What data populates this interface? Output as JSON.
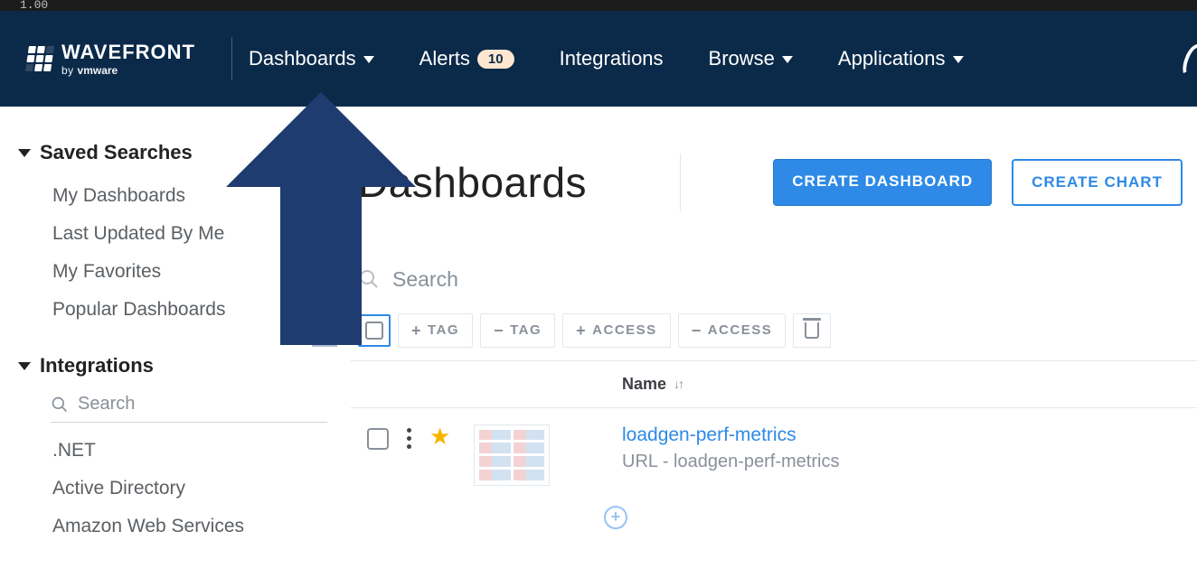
{
  "chrome": {
    "time": "1.00"
  },
  "brand": {
    "main": "WAVEFRONT",
    "sub_prefix": "by ",
    "sub_bold": "vmware"
  },
  "nav": {
    "dashboards": "Dashboards",
    "alerts": "Alerts",
    "alerts_badge": "10",
    "integrations": "Integrations",
    "browse": "Browse",
    "applications": "Applications"
  },
  "sidebar": {
    "saved_searches": {
      "title": "Saved Searches",
      "items": [
        "My Dashboards",
        "Last Updated By Me",
        "My Favorites",
        "Popular Dashboards"
      ]
    },
    "integrations": {
      "title": "Integrations",
      "search_placeholder": "Search",
      "items": [
        ".NET",
        "Active Directory",
        "Amazon Web Services"
      ]
    }
  },
  "page": {
    "title": "Dashboards",
    "create_dashboard": "CREATE DASHBOARD",
    "create_chart": "CREATE CHART",
    "search_placeholder": "Search"
  },
  "toolbar": {
    "add_tag": "TAG",
    "remove_tag": "TAG",
    "add_access": "ACCESS",
    "remove_access": "ACCESS"
  },
  "table": {
    "header_name": "Name",
    "rows": [
      {
        "title": "loadgen-perf-metrics",
        "subtitle": "URL - loadgen-perf-metrics",
        "favorite": true
      }
    ]
  }
}
